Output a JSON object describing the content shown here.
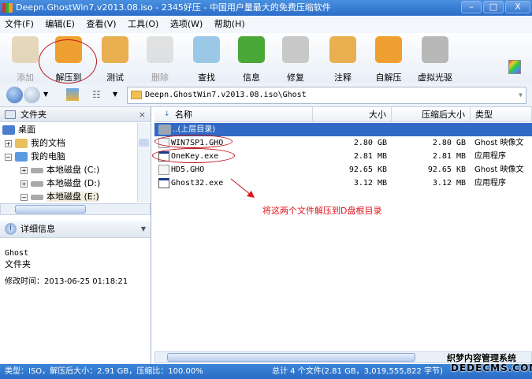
{
  "window": {
    "title": "Deepn.GhostWin7.v2013.08.iso - 2345好压 - 中国用户量最大的免费压缩软件",
    "minimize": "–",
    "maximize": "□",
    "close": "X"
  },
  "menu": [
    "文件(F)",
    "编辑(E)",
    "查看(V)",
    "工具(O)",
    "选项(W)",
    "帮助(H)"
  ],
  "toolbar": [
    {
      "label": "添加",
      "icon": "add-icon",
      "disabled": true,
      "color": "#d8c090"
    },
    {
      "label": "解压到",
      "icon": "extract-icon",
      "disabled": false,
      "color": "#f0a030"
    },
    {
      "label": "测试",
      "icon": "test-clipboard-icon",
      "disabled": false,
      "color": "#e8b050"
    },
    {
      "label": "删除",
      "icon": "trash-icon",
      "disabled": true,
      "color": "#d0d0d0"
    },
    {
      "label": "查找",
      "icon": "magnifier-icon",
      "disabled": false,
      "color": "#9cc8e8"
    },
    {
      "label": "信息",
      "icon": "info-icon",
      "disabled": false,
      "color": "#4aa838"
    },
    {
      "label": "修复",
      "icon": "first-aid-icon",
      "disabled": false,
      "color": "#c8c8c8"
    },
    {
      "label": "注释",
      "icon": "notepad-pencil-icon",
      "disabled": false,
      "color": "#e8b050"
    },
    {
      "label": "自解压",
      "icon": "sfx-folder-icon",
      "disabled": false,
      "color": "#f0a030"
    },
    {
      "label": "虚拟光驱",
      "icon": "virtual-drive-icon",
      "disabled": false,
      "color": "#b8b8b8"
    }
  ],
  "address": {
    "path": "Deepn.GhostWin7.v2013.08.iso\\Ghost"
  },
  "folder_pane": {
    "title": "文件夹",
    "close": "×",
    "tree": [
      {
        "label": "桌面",
        "expander": ""
      },
      {
        "label": "我的文档",
        "expander": "+"
      },
      {
        "label": "我的电脑",
        "expander": "−"
      },
      {
        "label": "本地磁盘 (C:)",
        "expander": "+"
      },
      {
        "label": "本地磁盘 (D:)",
        "expander": "+"
      },
      {
        "label": "本地磁盘 (E:)",
        "expander": "−"
      }
    ]
  },
  "details_pane": {
    "title": "详细信息",
    "name": "Ghost",
    "type": "文件夹",
    "modified": "修改时间：2013-06-25 01:18:21"
  },
  "file_list": {
    "columns": {
      "name": "名称",
      "size": "大小",
      "packed": "压缩后大小",
      "type": "类型"
    },
    "rows": [
      {
        "name": "..(上层目录)",
        "size": "",
        "packed": "",
        "type": "",
        "selected": true
      },
      {
        "name": "WIN7SP1.GHO",
        "size": "2.80 GB",
        "packed": "2.80 GB",
        "type": "Ghost 映像文"
      },
      {
        "name": "OneKey.exe",
        "size": "2.81 MB",
        "packed": "2.81 MB",
        "type": "应用程序"
      },
      {
        "name": "HD5.GHO",
        "size": "92.65 KB",
        "packed": "92.65 KB",
        "type": "Ghost 映像文"
      },
      {
        "name": "Ghost32.exe",
        "size": "3.12 MB",
        "packed": "3.12 MB",
        "type": "应用程序"
      }
    ]
  },
  "annotation": {
    "text": "将这两个文件解压到D盘根目录",
    "color": "#e0141c"
  },
  "status": {
    "left": "类型：ISO，解压后大小：2.91 GB，压缩比：100.00%",
    "right": "总计 4 个文件(2.81 GB，3,019,555,822 字节)"
  },
  "watermark": {
    "line1": "织梦内容管理系统",
    "line2": "DEDECMS.COM"
  }
}
